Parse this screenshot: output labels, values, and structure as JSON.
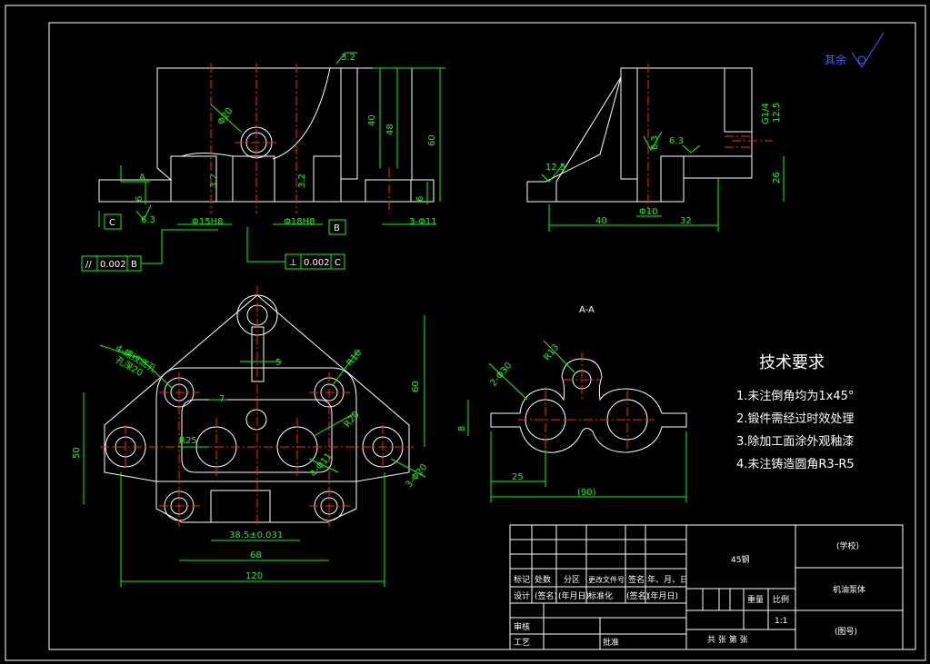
{
  "roughness": "其余",
  "tech_title": "技术要求",
  "notes": [
    "1.未注倒角均为1x45°",
    "2.锻件需经过时效处理",
    "3.除加工面涂外观釉漆",
    "4.未注铸造圆角R3-R5"
  ],
  "section_label": "A-A",
  "front_dims": {
    "ra32": "3.2",
    "d40": "40",
    "d48": "48",
    "d60": "60",
    "phi20": "Φ20",
    "d6": "6",
    "d6b": "6",
    "ra32b": "3.2",
    "ra32c": "3.2",
    "ra63": "6.3",
    "phi15": "Φ15H8",
    "phi18": "Φ18H8",
    "holes": "3-Φ11",
    "datA": "A",
    "datB": "B",
    "datC": "C",
    "tol1_val": "0.002",
    "tol1_ref": "B",
    "tol2_val": "0.002",
    "tol2_ref": "C"
  },
  "side_dims": {
    "g14": "G1/4",
    "ra125": "12.5",
    "ra63a": "6.3",
    "ra63b": "6.3",
    "ra125b": "12.5",
    "d26": "26",
    "phi10": "Φ10",
    "d40": "40",
    "d32": "32"
  },
  "plan_dims": {
    "d5": "5",
    "r10": "R10",
    "d60": "60",
    "d7": "7",
    "r20": "R20",
    "r25": "R25",
    "d50": "50",
    "slot": "3-Φ20",
    "holes4": "4-Φ11",
    "note": "4-螺纹底孔",
    "note2": "孔深20",
    "d385": "38.5±0.031",
    "d68": "68",
    "d120": "120"
  },
  "sect_dims": {
    "r13": "R13",
    "phi30": "2-Φ30",
    "d8": "8",
    "d25": "25",
    "d90": "(90)"
  },
  "title_block": {
    "material": "45钢",
    "school": "(学校)",
    "part_name": "机油泵体",
    "drawing_no": "(图号)",
    "mark": "标记",
    "count": "处数",
    "zone": "分区",
    "doc": "更改文件号",
    "sign": "签名",
    "date": "年、月、日",
    "design": "设计",
    "sig1": "(签名)",
    "date1": "(年月日)",
    "std": "标准化",
    "sig2": "(签名)",
    "date2": "(年月日)",
    "weight": "重量",
    "scale": "比例",
    "scale_val": "1:1",
    "review": "审核",
    "process": "工艺",
    "approve": "批准",
    "sheets": "共  张  第  张"
  }
}
